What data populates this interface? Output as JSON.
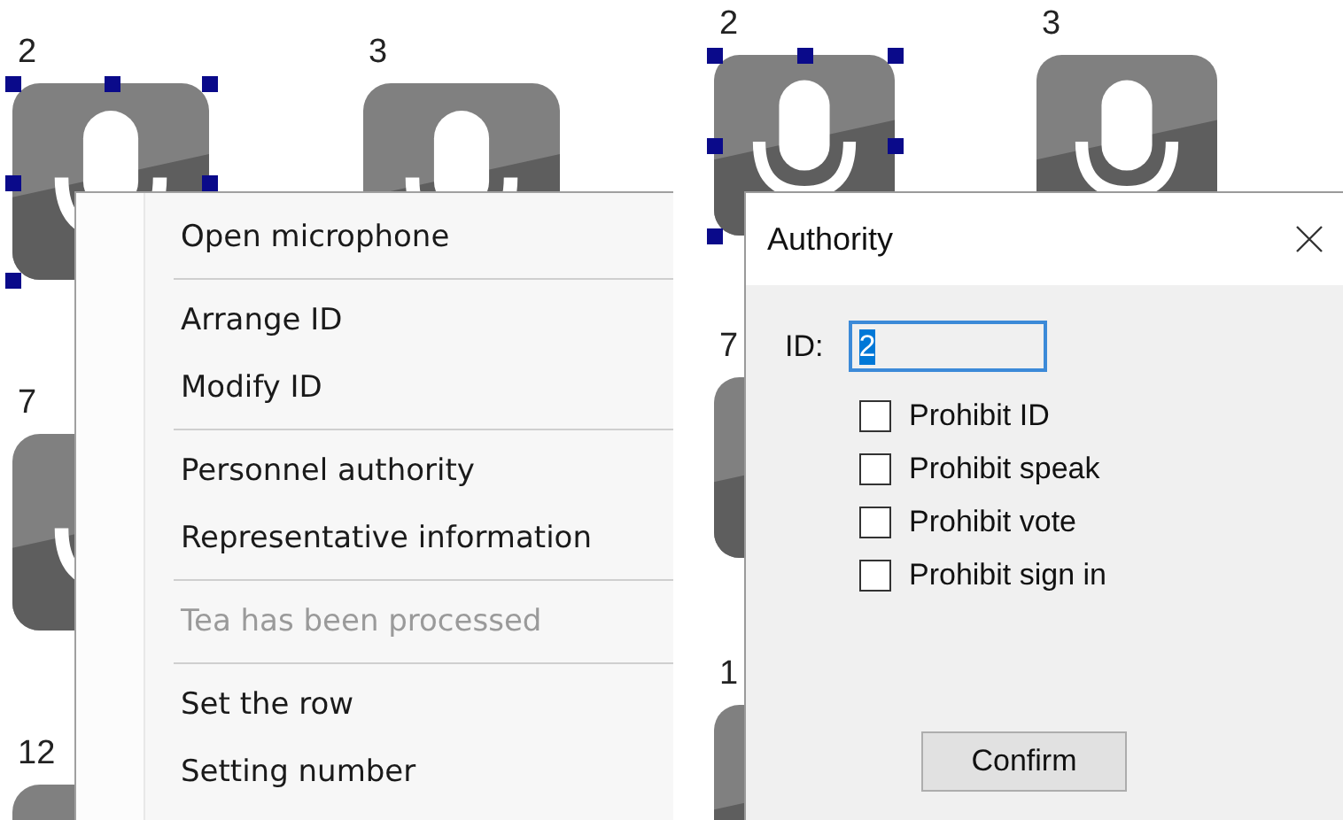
{
  "left_panel": {
    "tiles": [
      {
        "number": "2",
        "selected": true
      },
      {
        "number": "3",
        "selected": false
      },
      {
        "number": "7",
        "selected": false
      },
      {
        "number": "12",
        "selected": false
      }
    ],
    "context_menu": {
      "groups": [
        [
          {
            "label": "Open microphone",
            "disabled": false
          }
        ],
        [
          {
            "label": "Arrange ID",
            "disabled": false
          },
          {
            "label": "Modify ID",
            "disabled": false
          }
        ],
        [
          {
            "label": "Personnel authority",
            "disabled": false
          },
          {
            "label": "Representative information",
            "disabled": false
          }
        ],
        [
          {
            "label": "Tea has been processed",
            "disabled": true
          }
        ],
        [
          {
            "label": "Set the row",
            "disabled": false
          },
          {
            "label": "Setting number",
            "disabled": false
          }
        ]
      ]
    }
  },
  "right_panel": {
    "tiles": [
      {
        "number": "2",
        "selected": true
      },
      {
        "number": "3",
        "selected": false
      },
      {
        "number": "7",
        "selected": false
      },
      {
        "number": "1",
        "selected": false
      }
    ],
    "dialog": {
      "title": "Authority",
      "id_label": "ID:",
      "id_value": "2",
      "checkboxes": [
        {
          "label": "Prohibit ID",
          "checked": false
        },
        {
          "label": "Prohibit speak",
          "checked": false
        },
        {
          "label": "Prohibit vote",
          "checked": false
        },
        {
          "label": "Prohibit sign in",
          "checked": false
        }
      ],
      "button": "Confirm"
    }
  }
}
